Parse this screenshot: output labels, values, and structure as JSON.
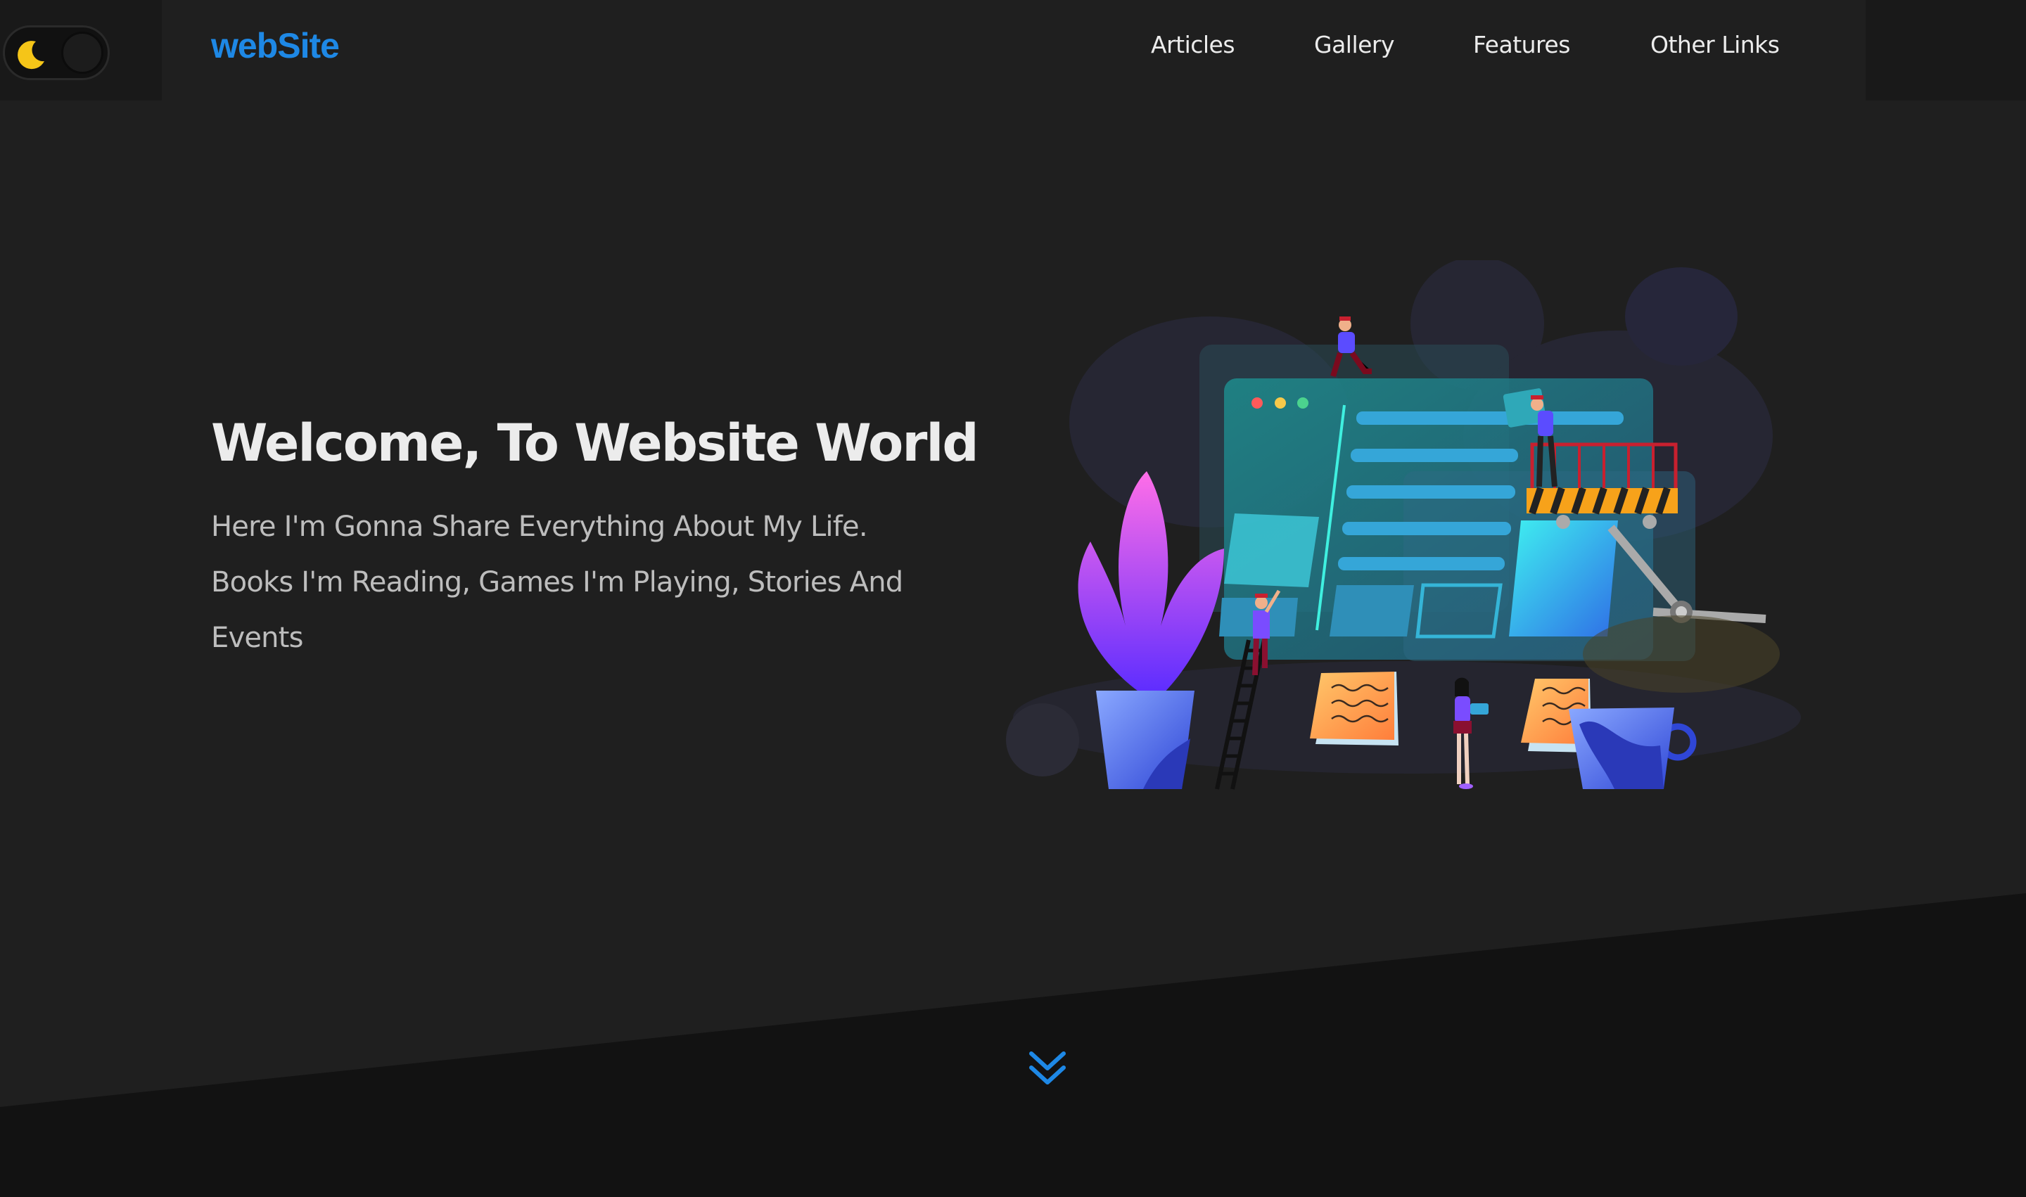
{
  "theme_toggle": {
    "icon": "moon-icon",
    "state": "dark"
  },
  "header": {
    "logo": "webSite",
    "nav": [
      {
        "label": "Articles"
      },
      {
        "label": "Gallery"
      },
      {
        "label": "Features"
      },
      {
        "label": "Other Links"
      }
    ]
  },
  "hero": {
    "title": "Welcome, To Website World",
    "description": "Here I'm Gonna Share Everything About My Life. Books I'm Reading, Games I'm Playing, Stories And Events",
    "illustration": "website-construction-illustration"
  },
  "scroll_icon": "chevrons-down-icon",
  "colors": {
    "accent": "#1e88e5",
    "background": "#1f1f1f",
    "band": "#121212",
    "moon": "#f5c518"
  }
}
